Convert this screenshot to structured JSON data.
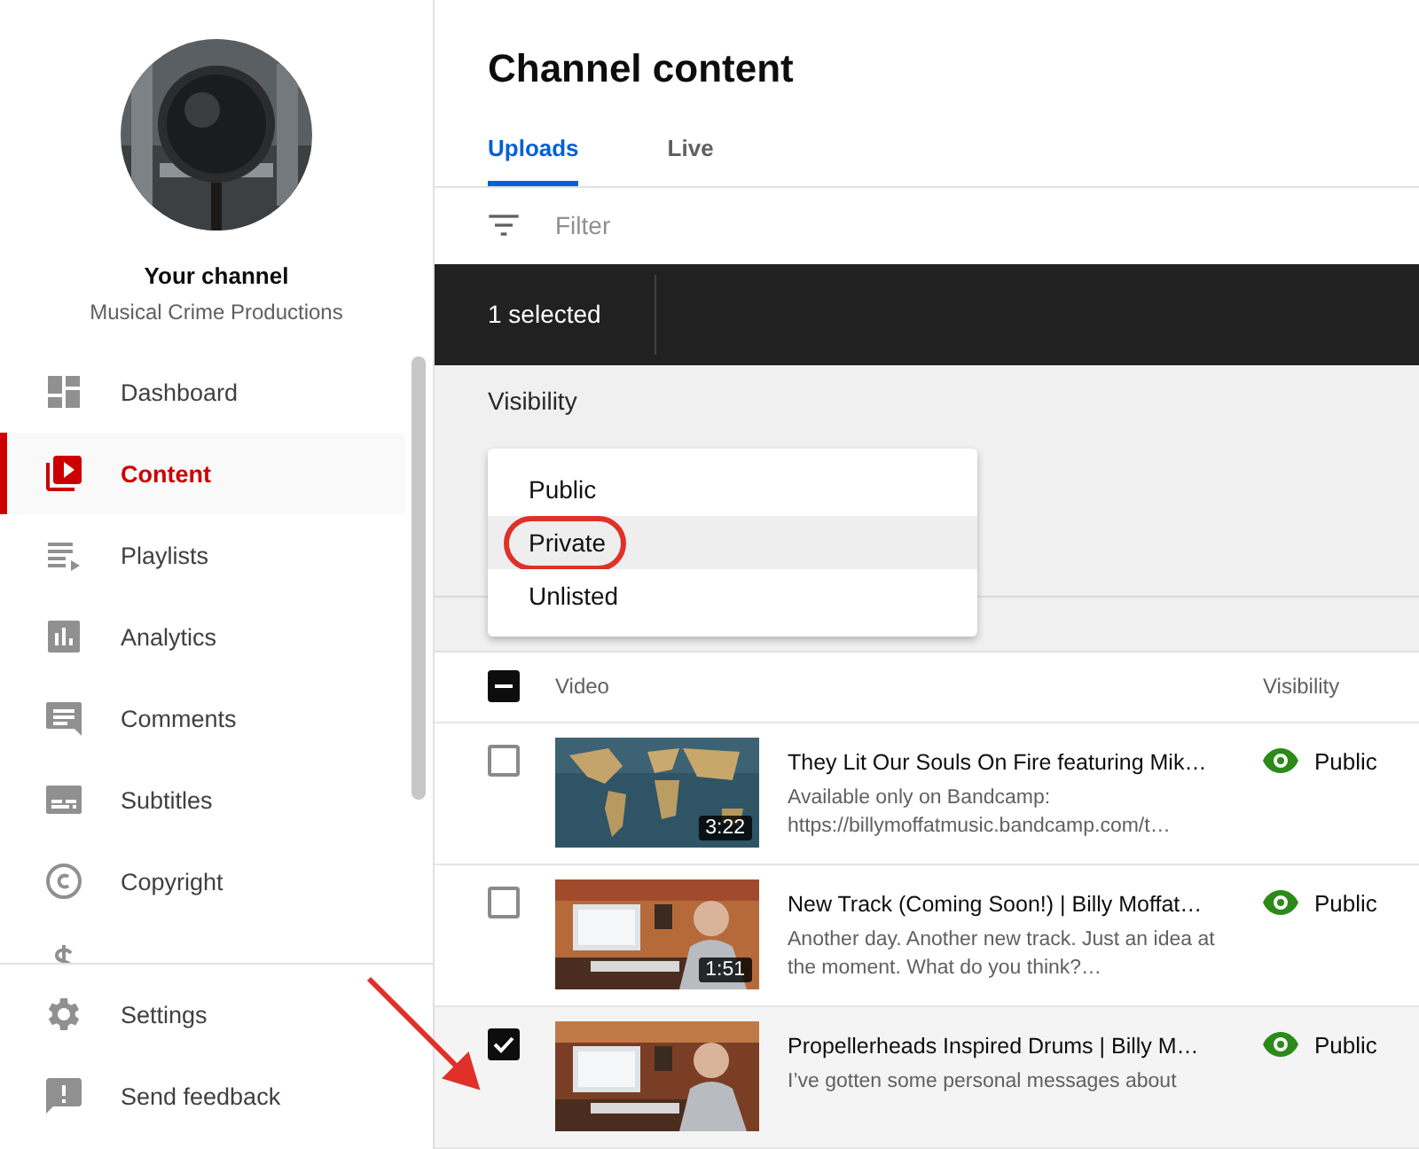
{
  "channel": {
    "title": "Your channel",
    "name": "Musical Crime Productions"
  },
  "nav": [
    {
      "label": "Dashboard",
      "selected": false
    },
    {
      "label": "Content",
      "selected": true
    },
    {
      "label": "Playlists",
      "selected": false
    },
    {
      "label": "Analytics",
      "selected": false
    },
    {
      "label": "Comments",
      "selected": false
    },
    {
      "label": "Subtitles",
      "selected": false
    },
    {
      "label": "Copyright",
      "selected": false
    },
    {
      "selected": false
    }
  ],
  "nav_bottom": [
    {
      "label": "Settings"
    },
    {
      "label": "Send feedback"
    }
  ],
  "page_title": "Channel content",
  "tabs": [
    {
      "label": "Uploads",
      "selected": true
    },
    {
      "label": "Live",
      "selected": false
    }
  ],
  "filter": {
    "placeholder": "Filter"
  },
  "selection_bar": {
    "count": "1 selected"
  },
  "visibility_panel": {
    "label": "Visibility",
    "options": [
      {
        "label": "Public",
        "selected": false,
        "circled": false
      },
      {
        "label": "Private",
        "selected": true,
        "circled": true
      },
      {
        "label": "Unlisted",
        "selected": false,
        "circled": false
      }
    ]
  },
  "table": {
    "columns": [
      "Video",
      "Visibility"
    ],
    "select_all": {
      "indeterminate": true
    },
    "rows": [
      {
        "title": "They Lit Our Souls On Fire featuring Mik…",
        "description": "Available only on Bandcamp: https://billymoffatmusic.bandcamp.com/t…",
        "duration": "3:22",
        "visibility": "Public",
        "checked": false,
        "arrow": false
      },
      {
        "title": "New Track (Coming Soon!) | Billy Moffat…",
        "description": "Another day. Another new track. Just an idea at the moment. What do you think?…",
        "duration": "1:51",
        "visibility": "Public",
        "checked": false,
        "arrow": false
      },
      {
        "title": "Propellerheads Inspired Drums | Billy M…",
        "description": "I’ve gotten some personal messages about",
        "visibility": "Public",
        "checked": true,
        "arrow": true
      }
    ]
  }
}
